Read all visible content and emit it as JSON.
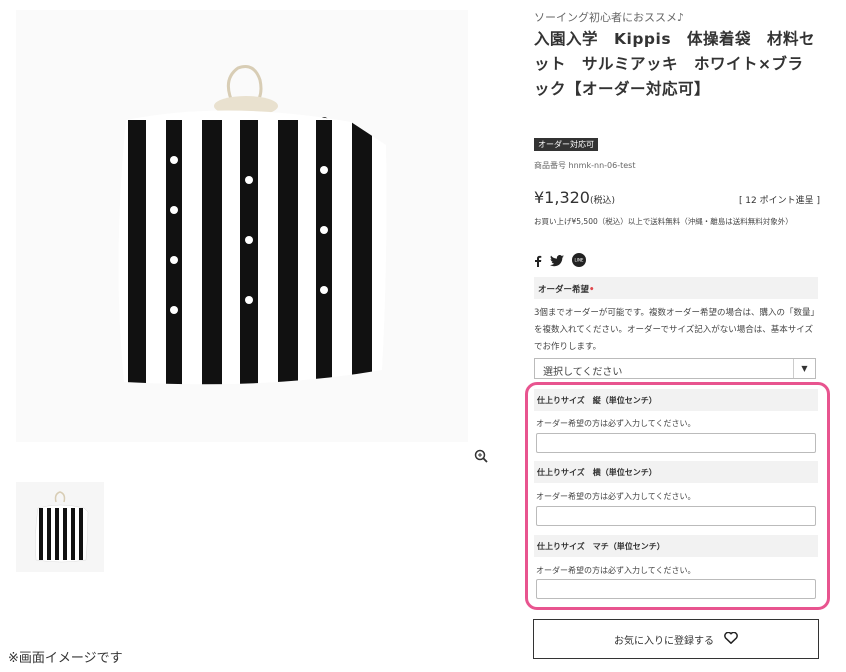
{
  "product": {
    "catch_copy": "ソーイング初心者におススメ♪",
    "title": "入園入学　Kippis　体操着袋　材料セット　サルミアッキ　ホワイト×ブラック【オーダー対応可】",
    "badge": "オーダー対応可",
    "code": "商品番号 hnmk-nn-06-test",
    "price": "¥1,320",
    "price_tax": "(税込)",
    "points": "[ 12 ポイント進呈 ]",
    "shipping_note": "お買い上げ¥5,500（税込）以上で送料無料（沖縄・離島は送料無料対象外）"
  },
  "gallery": {
    "note": "※画面イメージです"
  },
  "social": {
    "line_label": "LINE"
  },
  "order_option": {
    "header": "オーダー希望",
    "required_mark": "•",
    "description": "3個までオーダーが可能です。複数オーダー希望の場合は、購入の「数量」を複数入れてください。オーダーでサイズ記入がない場合は、基本サイズでお作りします。",
    "select_value": "選択してください"
  },
  "size_fields": [
    {
      "label": "仕上りサイズ　縦（単位センチ）",
      "hint": "オーダー希望の方は必ず入力してください。",
      "value": ""
    },
    {
      "label": "仕上りサイズ　横（単位センチ）",
      "hint": "オーダー希望の方は必ず入力してください。",
      "value": ""
    },
    {
      "label": "仕上りサイズ　マチ（単位センチ）",
      "hint": "オーダー希望の方は必ず入力してください。",
      "value": ""
    }
  ],
  "favorite_button": {
    "label": "お気に入りに登録する"
  },
  "colors": {
    "highlight": "#e8548f",
    "required": "#e0474c",
    "field_bg": "#f2f2f2"
  }
}
